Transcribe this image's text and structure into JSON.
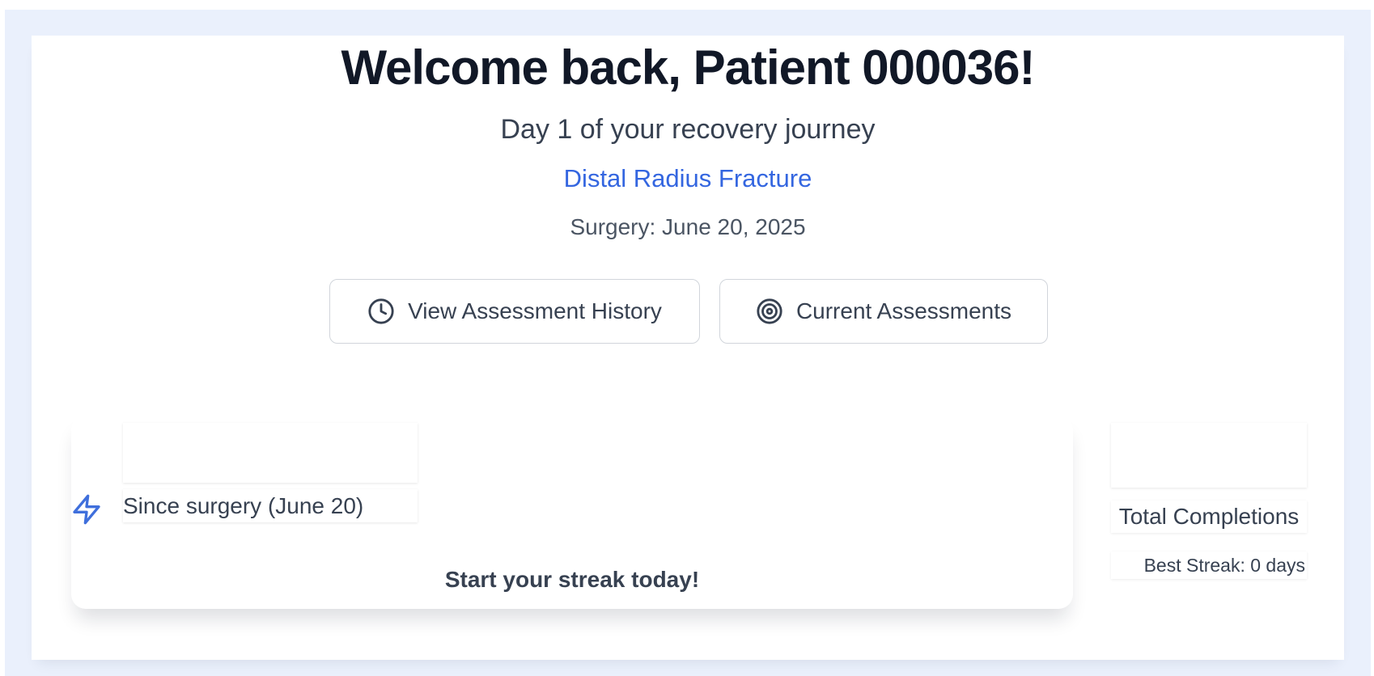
{
  "header": {
    "title": "Welcome back, Patient 000036!",
    "subtitle": "Day 1 of your recovery journey",
    "condition": "Distal Radius Fracture",
    "surgery": "Surgery: June 20, 2025"
  },
  "actions": {
    "history_label": "View Assessment History",
    "history_icon": "clock-icon",
    "current_label": "Current Assessments",
    "current_icon": "target-icon"
  },
  "streak": {
    "icon": "lightning-icon",
    "value": "",
    "since": "Since surgery (June 20)",
    "cta": "Start your streak today!"
  },
  "stats": {
    "total_value": "",
    "total_label": "Total Completions",
    "best_streak": "Best Streak: 0 days"
  },
  "colors": {
    "accent": "#3466e0",
    "page_bg": "#eaf0fc",
    "text_dark": "#111827",
    "text_muted": "#374151"
  }
}
